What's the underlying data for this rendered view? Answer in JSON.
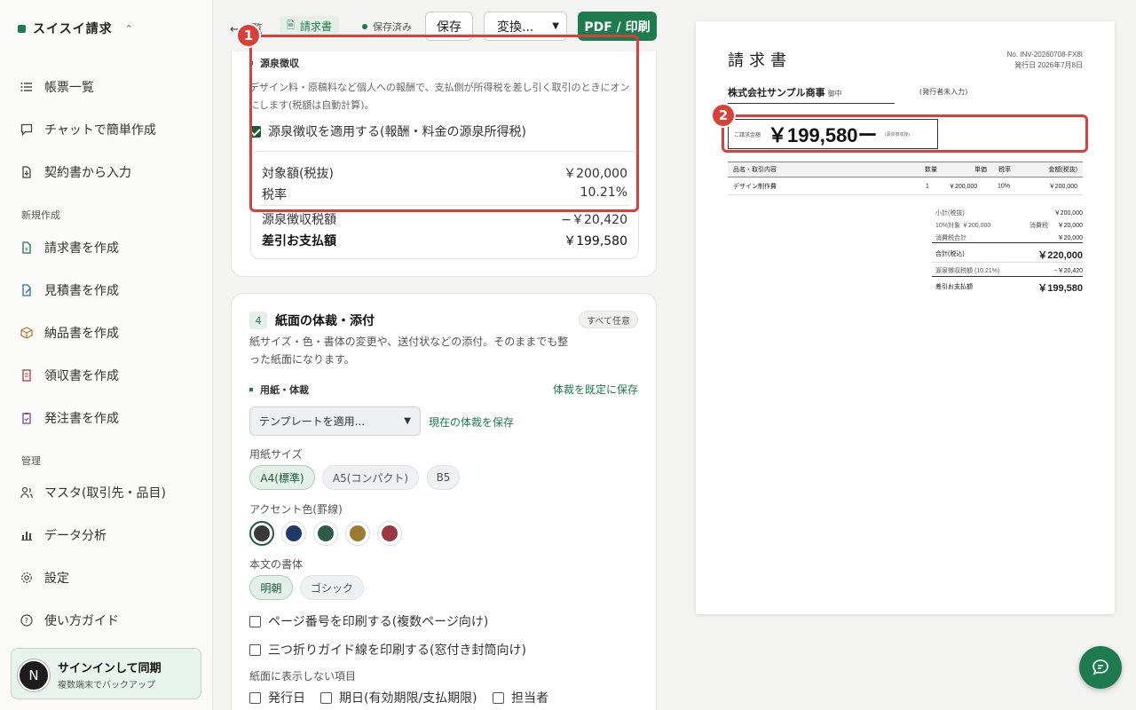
{
  "app": {
    "name": "スイスイ請求"
  },
  "sidebar": {
    "items": [
      {
        "label": "帳票一覧",
        "icon": "list-icon"
      },
      {
        "label": "チャットで簡単作成",
        "icon": "chat-icon"
      },
      {
        "label": "契約書から入力",
        "icon": "file-import-icon"
      }
    ],
    "section_new": "新規作成",
    "new_items": [
      {
        "label": "請求書を作成",
        "icon": "invoice-icon"
      },
      {
        "label": "見積書を作成",
        "icon": "quote-icon"
      },
      {
        "label": "納品書を作成",
        "icon": "box-icon"
      },
      {
        "label": "領収書を作成",
        "icon": "receipt-icon"
      },
      {
        "label": "発注書を作成",
        "icon": "order-icon"
      }
    ],
    "section_manage": "管理",
    "manage_items": [
      {
        "label": "マスタ(取引先・品目)",
        "icon": "users-icon"
      },
      {
        "label": "データ分析",
        "icon": "bar-chart-icon"
      },
      {
        "label": "設定",
        "icon": "gear-icon"
      },
      {
        "label": "使い方ガイド",
        "icon": "help-icon"
      }
    ],
    "signin": {
      "avatar": "N",
      "title": "サインインして同期",
      "subtitle": "複数端末でバックアップ"
    }
  },
  "toolbar": {
    "back_label": "←一覧",
    "doc_type": "請求書",
    "status": "保存済み",
    "save_label": "保存",
    "convert_label": "変換...",
    "pdf_label": "PDF / 印刷"
  },
  "withholding": {
    "title": "源泉徴収",
    "description_1": "デザイン料・原稿料など個人への報酬で、支払側が所得税を差し引く取引のときにオン",
    "description_2": "にします(税額は自動計算)。",
    "checkbox_label": "源泉徴収を適用する(報酬・料金の源泉所得税)",
    "checked": true,
    "rows": [
      {
        "label": "対象額(税抜)",
        "value": "￥200,000"
      },
      {
        "label": "税率",
        "value": "10.21%"
      },
      {
        "label": "源泉徴収税額",
        "value": "−￥20,420"
      },
      {
        "label": "差引お支払額",
        "value": "￥199,580"
      }
    ]
  },
  "layout_section": {
    "number": "4",
    "title": "紙面の体裁・添付",
    "badge": "すべて任意",
    "description_1": "紙サイズ・色・書体の変更や、送付状などの添付。そのままでも整",
    "description_2": "った紙面になります。",
    "sub_title": "用紙・体裁",
    "save_default_link": "体裁を既定に保存",
    "template_select": "テンプレートを適用...",
    "save_current_link": "現在の体裁を保存",
    "paper_size_label": "用紙サイズ",
    "paper_sizes": [
      "A4(標準)",
      "A5(コンパクト)",
      "B5"
    ],
    "accent_label": "アクセント色(罫線)",
    "accent_colors": [
      "#3a3a3a",
      "#1f3a66",
      "#2e5a4a",
      "#9a7b2f",
      "#9a3a40"
    ],
    "font_label": "本文の書体",
    "fonts": [
      "明朝",
      "ゴシック"
    ],
    "check_page_numbers": "ページ番号を印刷する(複数ページ向け)",
    "check_fold_guide": "三つ折りガイド線を印刷する(窓付き封筒向け)",
    "hide_label": "紙面に表示しない項目",
    "hide_items": [
      "発行日",
      "期日(有効期限/支払期限)",
      "担当者"
    ]
  },
  "preview": {
    "title": "請求書",
    "doc_no": "No. INV-20260708-FX8I",
    "issue_date": "発行日 2026年7月8日",
    "client": "株式会社サンプル商事",
    "client_suffix": "御中",
    "issuer": "(発行者未入力)",
    "total_label": "ご請求金額",
    "total_amount": "￥199,580ー",
    "total_note": "(源泉徴収後)",
    "table_headers": [
      "品名・取引内容",
      "数量",
      "単価",
      "税率",
      "金額(税抜)"
    ],
    "table_rows": [
      [
        "デザイン制作費",
        "1",
        "￥200,000",
        "10%",
        "￥200,000"
      ]
    ],
    "subtotal_label": "小計(税抜)",
    "subtotal": "￥200,000",
    "tax_target_label": "10%対象 ￥200,000",
    "tax_label": "消費税",
    "tax_value": "￥20,000",
    "tax_total_label": "消費税合計",
    "tax_total": "￥20,000",
    "grand_label": "合計(税込)",
    "grand": "￥220,000",
    "withholding_label": "源泉徴収税額 (10.21%)",
    "withholding_value": "−￥20,420",
    "net_label": "差引お支払額",
    "net": "￥199,580"
  },
  "callouts": [
    "1",
    "2"
  ],
  "colors": {
    "accent": "#1e7a4f",
    "callout": "#d9403a"
  }
}
